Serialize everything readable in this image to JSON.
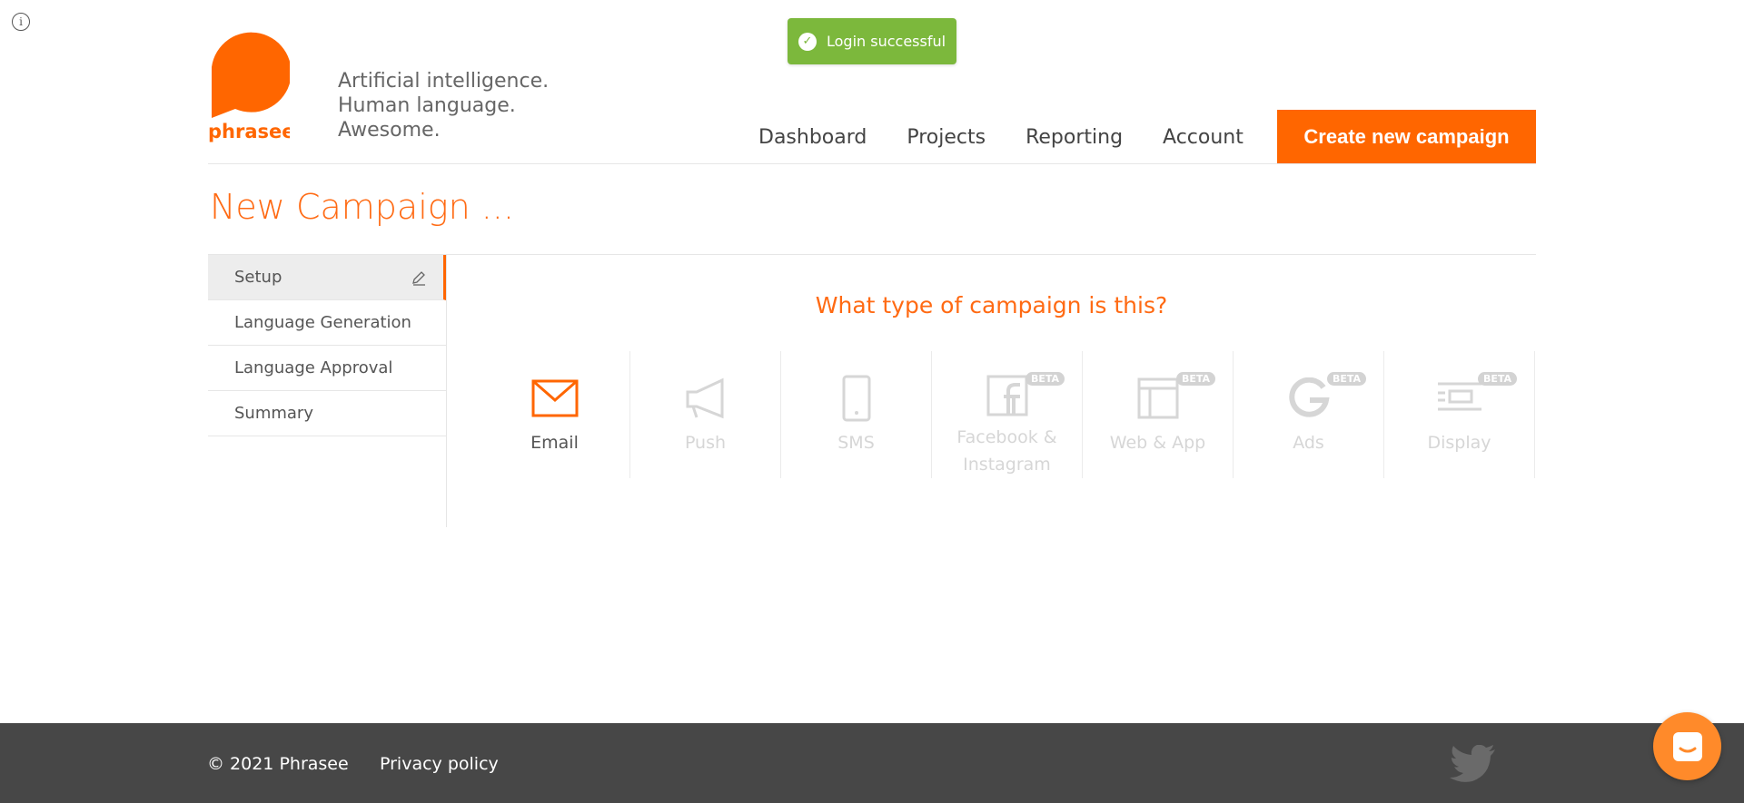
{
  "toast": {
    "message": "Login successful"
  },
  "brand": {
    "name": "phrasee",
    "tagline": [
      "Artificial intelligence.",
      "Human language.",
      "Awesome."
    ],
    "accent": "#ff6600"
  },
  "nav": {
    "items": [
      "Dashboard",
      "Projects",
      "Reporting",
      "Account"
    ],
    "cta": "Create new campaign"
  },
  "page": {
    "title": "New Campaign ..."
  },
  "sidebar": {
    "items": [
      {
        "label": "Setup",
        "active": true
      },
      {
        "label": "Language Generation",
        "active": false
      },
      {
        "label": "Language Approval",
        "active": false
      },
      {
        "label": "Summary",
        "active": false
      }
    ]
  },
  "campaign": {
    "question": "What type of campaign is this?",
    "types": [
      {
        "label": "Email",
        "icon": "envelope-icon",
        "selected": true,
        "beta": false
      },
      {
        "label": "Push",
        "icon": "megaphone-icon",
        "selected": false,
        "beta": false
      },
      {
        "label": "SMS",
        "icon": "phone-icon",
        "selected": false,
        "beta": false
      },
      {
        "label": "Facebook & Instagram",
        "icon": "facebook-icon",
        "selected": false,
        "beta": true
      },
      {
        "label": "Web & App",
        "icon": "layout-icon",
        "selected": false,
        "beta": true
      },
      {
        "label": "Ads",
        "icon": "google-icon",
        "selected": false,
        "beta": true
      },
      {
        "label": "Display",
        "icon": "display-icon",
        "selected": false,
        "beta": true
      }
    ],
    "beta_label": "BETA"
  },
  "footer": {
    "copyright": "2021 Phrasee",
    "privacy": "Privacy policy"
  }
}
